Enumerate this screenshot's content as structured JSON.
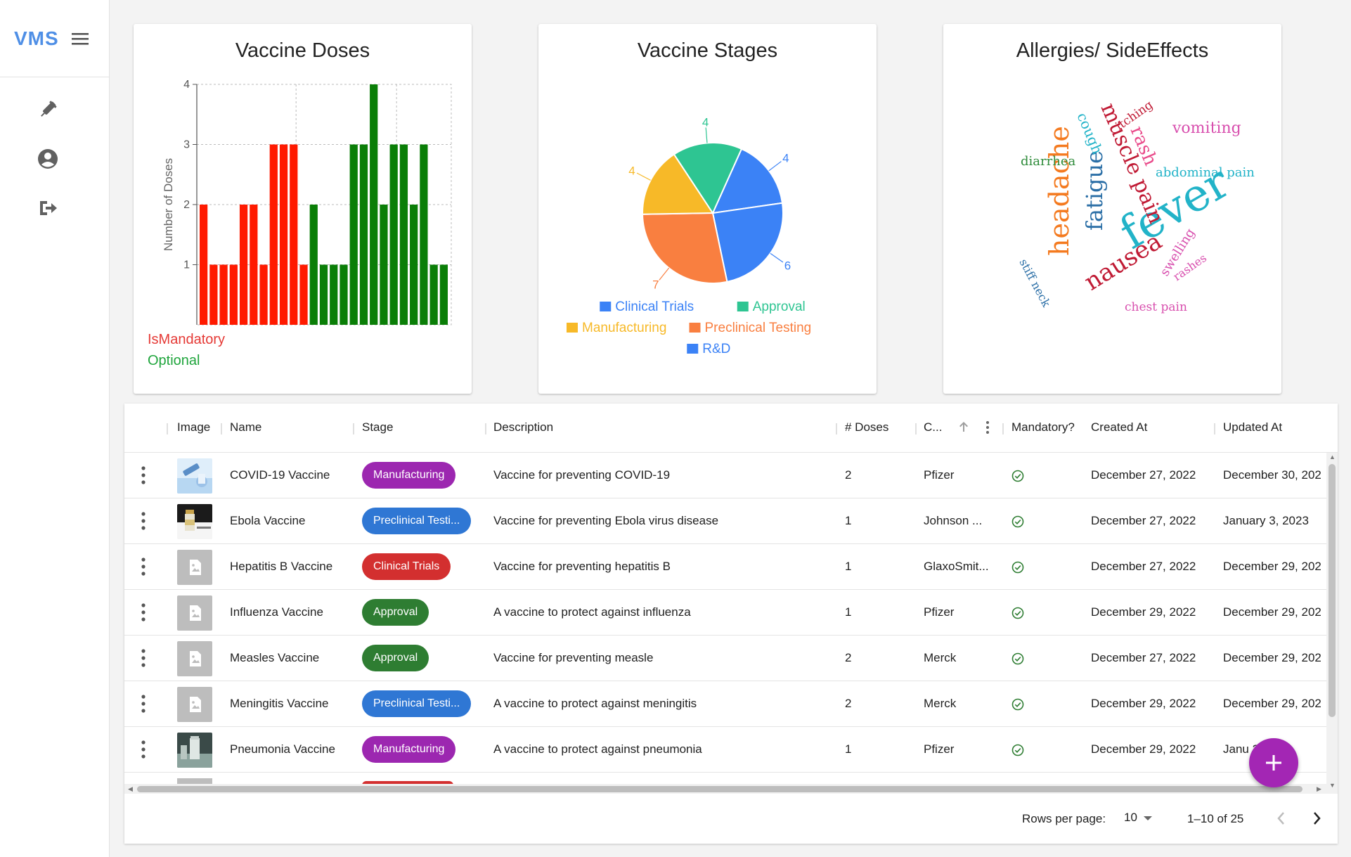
{
  "app": {
    "brand": "VMS"
  },
  "sidebar": {
    "items": [
      {
        "icon": "syringe-icon"
      },
      {
        "icon": "account-icon"
      },
      {
        "icon": "logout-icon"
      }
    ]
  },
  "cards": {
    "doses": {
      "title": "Vaccine Doses",
      "legend_mandatory": "IsMandatory",
      "legend_optional": "Optional"
    },
    "stages": {
      "title": "Vaccine Stages"
    },
    "allergies": {
      "title": "Allergies/ SideEffects"
    }
  },
  "colors": {
    "mandatory": "#ff1a00",
    "optional": "#0a7e07",
    "accent": "#a326b4"
  },
  "chart_data": [
    {
      "type": "bar",
      "title": "Vaccine Doses",
      "ylabel": "Number of Doses",
      "xlabel": "",
      "ylim": [
        0,
        4
      ],
      "yticks": [
        "1",
        "2",
        "3",
        "4"
      ],
      "series": [
        {
          "name": "IsMandatory",
          "color": "#ff1a00",
          "values": [
            2,
            1,
            1,
            1,
            2,
            2,
            1,
            3,
            3,
            3,
            1,
            null,
            null,
            null,
            null,
            null,
            null,
            null,
            null,
            null,
            null,
            null,
            null,
            null,
            null
          ]
        },
        {
          "name": "Optional",
          "color": "#0a7e07",
          "values": [
            null,
            null,
            null,
            null,
            null,
            null,
            null,
            null,
            null,
            null,
            null,
            2,
            1,
            1,
            1,
            3,
            3,
            4,
            2,
            3,
            3,
            2,
            3,
            1,
            1
          ]
        }
      ]
    },
    {
      "type": "pie",
      "title": "Vaccine Stages",
      "slices": [
        {
          "name": "Clinical Trials",
          "value": 4,
          "color": "#3b82f6"
        },
        {
          "name": "R&D",
          "value": 6,
          "color": "#3b82f6"
        },
        {
          "name": "Preclinical Testing",
          "value": 7,
          "color": "#f97f40"
        },
        {
          "name": "Manufacturing",
          "value": 4,
          "color": "#f7b928"
        },
        {
          "name": "Approval",
          "value": 4,
          "color": "#2ec592"
        }
      ],
      "legend": [
        "Clinical Trials",
        "Approval",
        "Manufacturing",
        "Preclinical Testing",
        "R&D"
      ]
    }
  ],
  "wordcloud": {
    "words": [
      {
        "text": "fever",
        "color": "#22b3c8"
      },
      {
        "text": "headache",
        "color": "#f47a1f"
      },
      {
        "text": "fatigue",
        "color": "#2a6ea6"
      },
      {
        "text": "muscle pain",
        "color": "#c01a34"
      },
      {
        "text": "nausea",
        "color": "#c01a34"
      },
      {
        "text": "rash",
        "color": "#e94a8a"
      },
      {
        "text": "cough",
        "color": "#22b3c8"
      },
      {
        "text": "itching",
        "color": "#c01a34"
      },
      {
        "text": "vomiting",
        "color": "#d84fae"
      },
      {
        "text": "diarrhea",
        "color": "#2e8b3a"
      },
      {
        "text": "abdominal pain",
        "color": "#22b3c8"
      },
      {
        "text": "swelling",
        "color": "#d84fae"
      },
      {
        "text": "rashes",
        "color": "#d84fae"
      },
      {
        "text": "chest pain",
        "color": "#d84fae"
      },
      {
        "text": "stiff neck",
        "color": "#2a6ea6"
      }
    ]
  },
  "table": {
    "columns": [
      "Image",
      "Name",
      "Stage",
      "Description",
      "# Doses",
      "C...",
      "Mandatory?",
      "Created At",
      "Updated At"
    ],
    "rows": [
      {
        "name": "COVID-19 Vaccine",
        "stage": "Manufacturing",
        "stage_color": "#9c27b0",
        "description": "Vaccine for preventing COVID-19",
        "doses": "2",
        "company": "Pfizer",
        "created": "December 27, 2022",
        "updated": "December 30, 202",
        "thumb": "covid"
      },
      {
        "name": "Ebola Vaccine",
        "stage": "Preclinical Testi...",
        "stage_color": "#2f77d4",
        "description": "Vaccine for preventing Ebola virus disease",
        "doses": "1",
        "company": "Johnson ...",
        "created": "December 27, 2022",
        "updated": "January 3, 2023",
        "thumb": "ebola"
      },
      {
        "name": "Hepatitis B Vaccine",
        "stage": "Clinical Trials",
        "stage_color": "#d32f2f",
        "description": "Vaccine for preventing hepatitis B",
        "doses": "1",
        "company": "GlaxoSmit...",
        "created": "December 27, 2022",
        "updated": "December 29, 202",
        "thumb": "none"
      },
      {
        "name": "Influenza Vaccine",
        "stage": "Approval",
        "stage_color": "#2e7d32",
        "description": "A vaccine to protect against influenza",
        "doses": "1",
        "company": "Pfizer",
        "created": "December 29, 2022",
        "updated": "December 29, 202",
        "thumb": "none"
      },
      {
        "name": "Measles Vaccine",
        "stage": "Approval",
        "stage_color": "#2e7d32",
        "description": "Vaccine for preventing measle",
        "doses": "2",
        "company": "Merck",
        "created": "December 27, 2022",
        "updated": "December 29, 202",
        "thumb": "none"
      },
      {
        "name": "Meningitis Vaccine",
        "stage": "Preclinical Testi...",
        "stage_color": "#2f77d4",
        "description": "A vaccine to protect against meningitis",
        "doses": "2",
        "company": "Merck",
        "created": "December 29, 2022",
        "updated": "December 29, 202",
        "thumb": "none"
      },
      {
        "name": "Pneumonia Vaccine",
        "stage": "Manufacturing",
        "stage_color": "#9c27b0",
        "description": "A vaccine to protect against pneumonia",
        "doses": "1",
        "company": "Pfizer",
        "created": "December 29, 2022",
        "updated": "Janu 2023",
        "thumb": "pneumonia"
      }
    ]
  },
  "pagination": {
    "rows_label": "Rows per page:",
    "rows_value": "10",
    "range": "1–10 of 25"
  }
}
